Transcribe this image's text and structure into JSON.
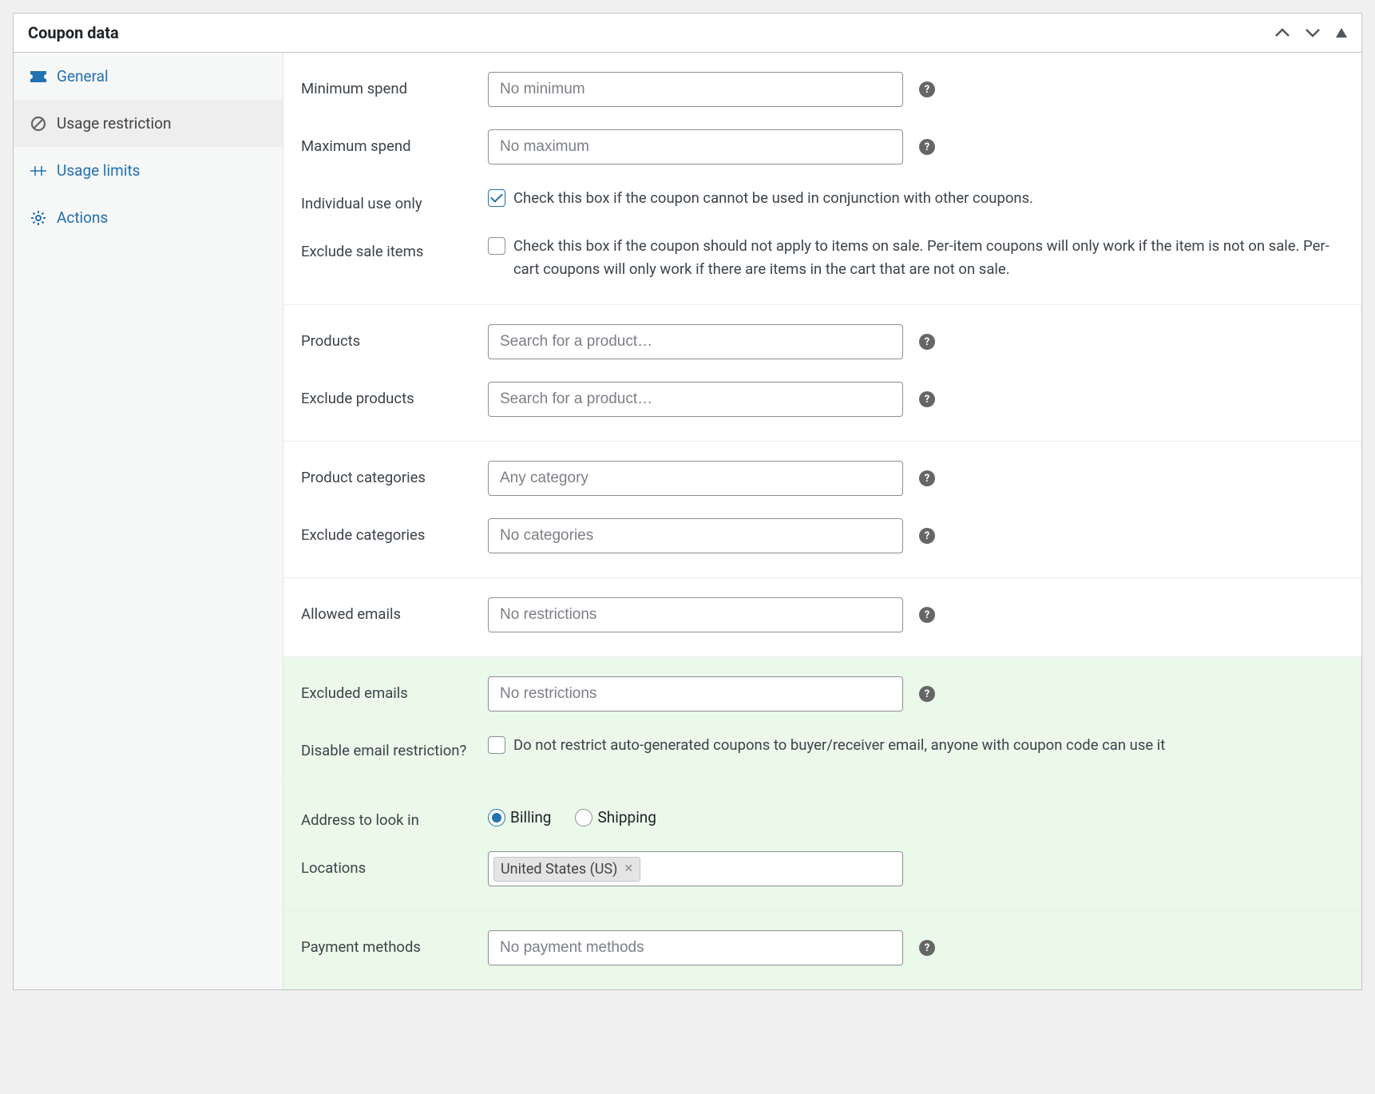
{
  "header": {
    "title": "Coupon data"
  },
  "sidebar": {
    "items": [
      {
        "label": "General"
      },
      {
        "label": "Usage restriction"
      },
      {
        "label": "Usage limits"
      },
      {
        "label": "Actions"
      }
    ]
  },
  "fields": {
    "min_spend": {
      "label": "Minimum spend",
      "placeholder": "No minimum"
    },
    "max_spend": {
      "label": "Maximum spend",
      "placeholder": "No maximum"
    },
    "individual_use": {
      "label": "Individual use only",
      "desc": "Check this box if the coupon cannot be used in conjunction with other coupons."
    },
    "exclude_sale": {
      "label": "Exclude sale items",
      "desc": "Check this box if the coupon should not apply to items on sale. Per-item coupons will only work if the item is not on sale. Per-cart coupons will only work if there are items in the cart that are not on sale."
    },
    "products": {
      "label": "Products",
      "placeholder": "Search for a product…"
    },
    "exclude_products": {
      "label": "Exclude products",
      "placeholder": "Search for a product…"
    },
    "product_categories": {
      "label": "Product categories",
      "placeholder": "Any category"
    },
    "exclude_categories": {
      "label": "Exclude categories",
      "placeholder": "No categories"
    },
    "allowed_emails": {
      "label": "Allowed emails",
      "placeholder": "No restrictions"
    },
    "excluded_emails": {
      "label": "Excluded emails",
      "placeholder": "No restrictions"
    },
    "disable_email_restriction": {
      "label": "Disable email restriction?",
      "desc": "Do not restrict auto-generated coupons to buyer/receiver email, anyone with coupon code can use it"
    },
    "address_lookin": {
      "label": "Address to look in",
      "opt_billing": "Billing",
      "opt_shipping": "Shipping"
    },
    "locations": {
      "label": "Locations",
      "chip": "United States (US)"
    },
    "payment_methods": {
      "label": "Payment methods",
      "placeholder": "No payment methods"
    }
  }
}
